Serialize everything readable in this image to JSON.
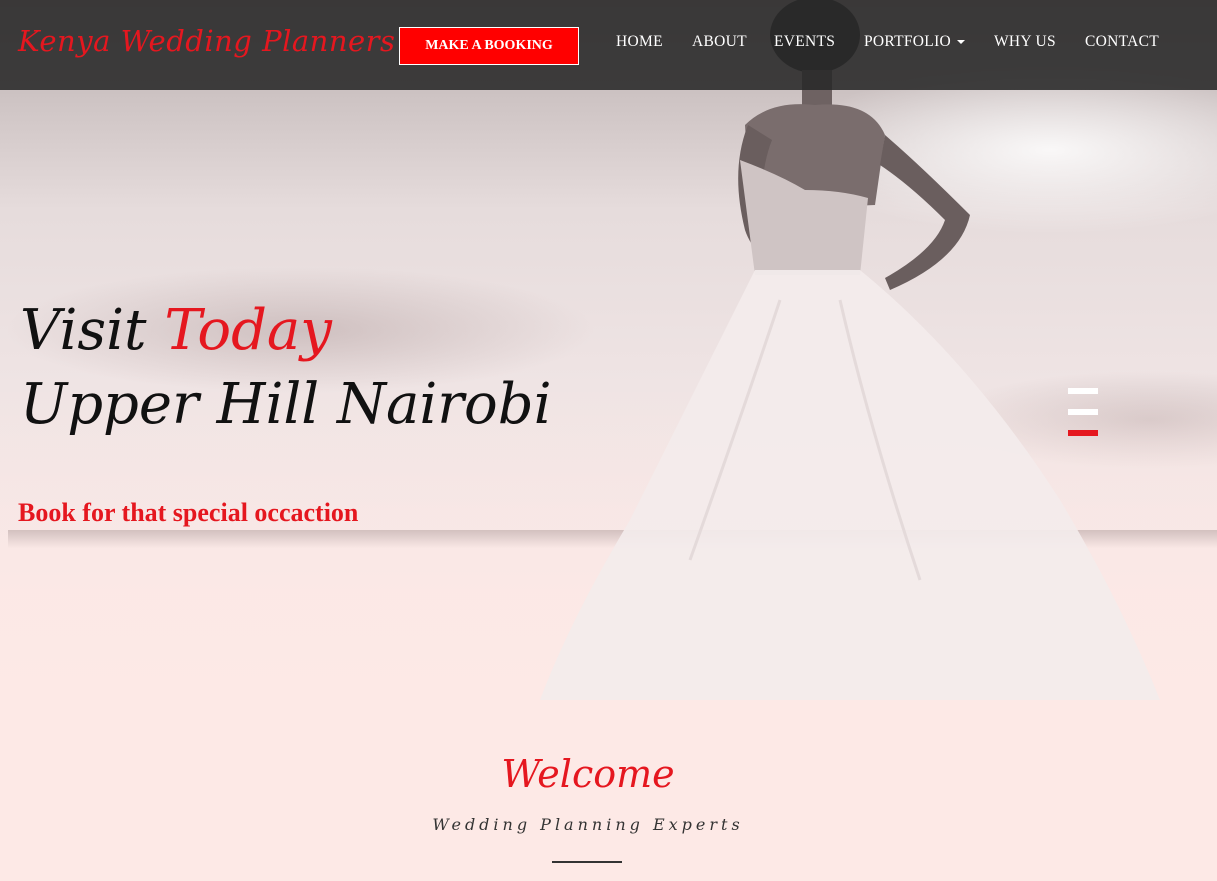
{
  "navbar": {
    "brand": "Kenya Wedding Planners",
    "booking_button": "MAKE A BOOKING",
    "items": [
      {
        "label": "HOME"
      },
      {
        "label": "ABOUT"
      },
      {
        "label": "EVENTS"
      },
      {
        "label": "PORTFOLIO",
        "has_dropdown": true
      },
      {
        "label": "WHY US"
      },
      {
        "label": "CONTACT"
      }
    ]
  },
  "hero": {
    "line1_part1": "Visit",
    "line1_part2": "Today",
    "line2": "Upper Hill Nairobi",
    "subtitle": "Book for that special occaction",
    "slider": {
      "total": 3,
      "active_index": 2
    }
  },
  "welcome": {
    "title": "Welcome",
    "subtitle": "Wedding Planning Experts"
  },
  "colors": {
    "accent": "#e5171f",
    "navbar_bg": "#282828",
    "page_bg": "#fde9e6"
  }
}
